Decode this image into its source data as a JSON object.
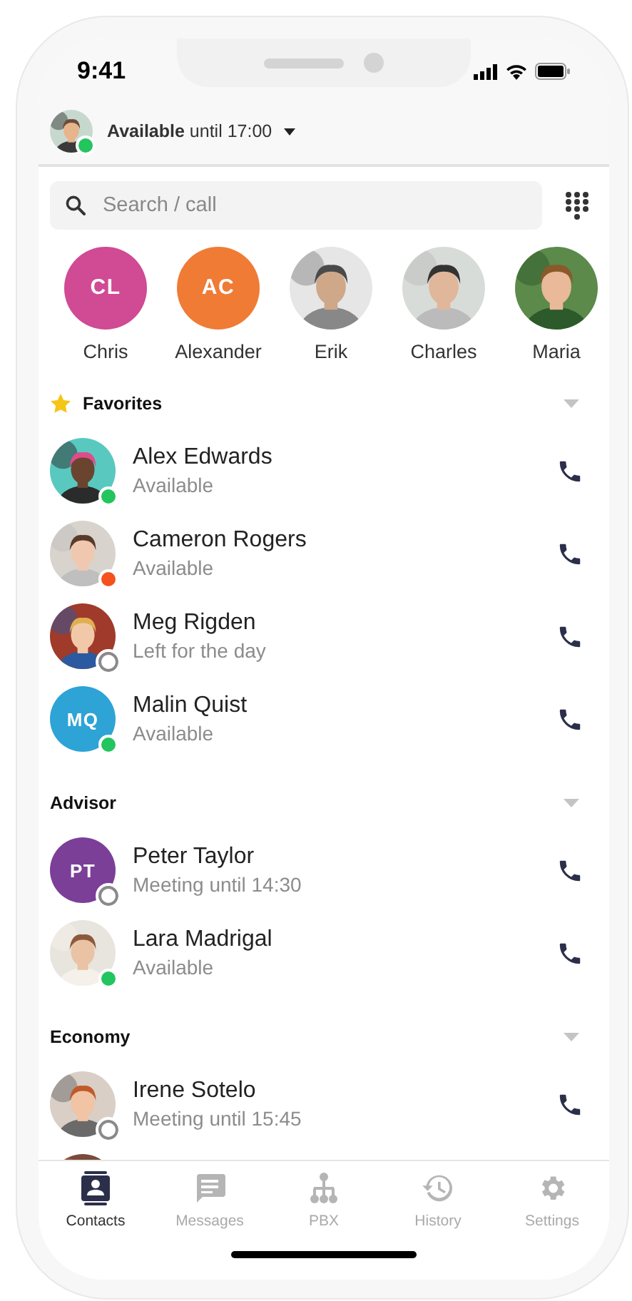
{
  "status_bar": {
    "time": "9:41"
  },
  "header": {
    "avatar": {
      "kind": "picture"
    },
    "presence": {
      "kind": "dot",
      "color": "#22c55e"
    },
    "status": "**Available** until 17:00"
  },
  "search": {
    "placeholder": "Search / call"
  },
  "quick_contacts": [
    {
      "name": "Chris",
      "avatar": {
        "kind": "initials",
        "initials": "CL",
        "color": "#d04a94"
      }
    },
    {
      "name": "Alexander",
      "avatar": {
        "kind": "initials",
        "initials": "AC",
        "color": "#f07b35"
      }
    },
    {
      "name": "Erik",
      "avatar": {
        "kind": "picture"
      }
    },
    {
      "name": "Charles",
      "avatar": {
        "kind": "picture"
      }
    },
    {
      "name": "Maria",
      "avatar": {
        "kind": "picture"
      }
    }
  ],
  "sections": [
    {
      "title": "Favorites",
      "starred": true,
      "contacts": [
        {
          "name": "Alex Edwards",
          "status": "Available",
          "presence": {
            "kind": "dot",
            "color": "#22c55e"
          },
          "avatar": {
            "kind": "picture"
          }
        },
        {
          "name": "Cameron Rogers",
          "status": "Available",
          "presence": {
            "kind": "dot",
            "color": "#f4511e"
          },
          "avatar": {
            "kind": "picture"
          }
        },
        {
          "name": "Meg Rigden",
          "status": "Left for the day",
          "presence": {
            "kind": "ring"
          },
          "avatar": {
            "kind": "picture"
          }
        },
        {
          "name": "Malin Quist",
          "status": "Available",
          "presence": {
            "kind": "dot",
            "color": "#22c55e"
          },
          "avatar": {
            "kind": "initials",
            "initials": "MQ",
            "color": "#2ea3d6"
          }
        }
      ]
    },
    {
      "title": "Advisor",
      "starred": false,
      "contacts": [
        {
          "name": "Peter Taylor",
          "status": "Meeting until 14:30",
          "presence": {
            "kind": "ring"
          },
          "avatar": {
            "kind": "initials",
            "initials": "PT",
            "color": "#7b3f98"
          }
        },
        {
          "name": "Lara Madrigal",
          "status": "Available",
          "presence": {
            "kind": "dot",
            "color": "#22c55e"
          },
          "avatar": {
            "kind": "picture"
          }
        }
      ]
    },
    {
      "title": "Economy",
      "starred": false,
      "contacts": [
        {
          "name": "Irene Sotelo",
          "status": "Meeting until 15:45",
          "presence": {
            "kind": "ring"
          },
          "avatar": {
            "kind": "picture"
          }
        },
        {
          "avatar": {
            "kind": "picture"
          }
        }
      ]
    }
  ],
  "tabs": [
    {
      "label": "Contacts",
      "selected": true
    },
    {
      "label": "Messages",
      "selected": false
    },
    {
      "label": "PBX",
      "selected": false
    },
    {
      "label": "History",
      "selected": false
    },
    {
      "label": "Settings",
      "selected": false
    }
  ]
}
